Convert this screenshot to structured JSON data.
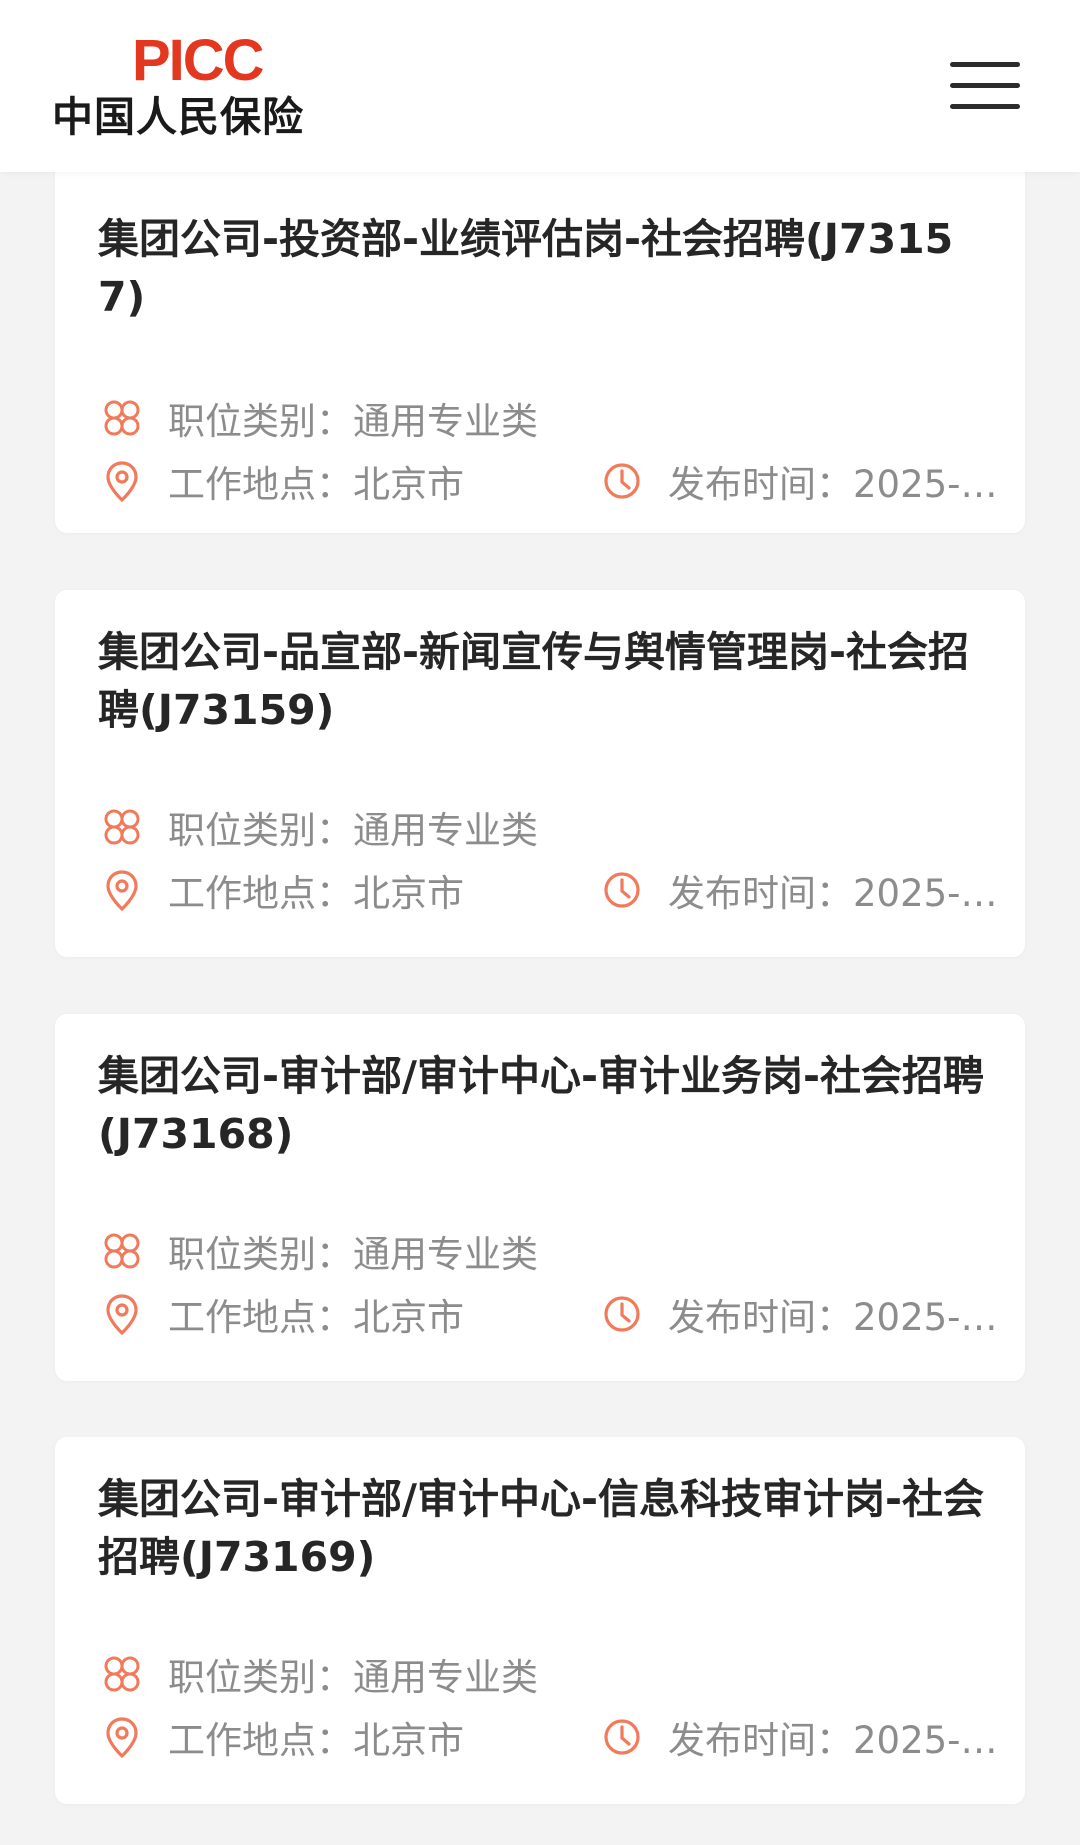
{
  "header": {
    "logo_brand": "PICC",
    "logo_name": "中国人民保险",
    "menu_icon": "hamburger-menu-icon"
  },
  "colors": {
    "brand_red": "#e3381f",
    "icon_orange": "#f07a5a",
    "title_text": "#262626",
    "meta_text": "#8c8c8c",
    "background": "#f3f3f3"
  },
  "icons": {
    "category": "four-petal-category-icon",
    "location": "location-pin-icon",
    "time": "clock-icon"
  },
  "jobs": [
    {
      "title": "集团公司-投资部-业绩评估岗-社会招聘(J73157)",
      "category": "职位类别：通用专业类",
      "location": "工作地点：北京市",
      "published": "发布时间：2025-…"
    },
    {
      "title": "集团公司-品宣部-新闻宣传与舆情管理岗-社会招聘(J73159)",
      "category": "职位类别：通用专业类",
      "location": "工作地点：北京市",
      "published": "发布时间：2025-…"
    },
    {
      "title": "集团公司-审计部/审计中心-审计业务岗-社会招聘(J73168)",
      "category": "职位类别：通用专业类",
      "location": "工作地点：北京市",
      "published": "发布时间：2025-…"
    },
    {
      "title": "集团公司-审计部/审计中心-信息科技审计岗-社会招聘(J73169)",
      "category": "职位类别：通用专业类",
      "location": "工作地点：北京市",
      "published": "发布时间：2025-…"
    }
  ]
}
